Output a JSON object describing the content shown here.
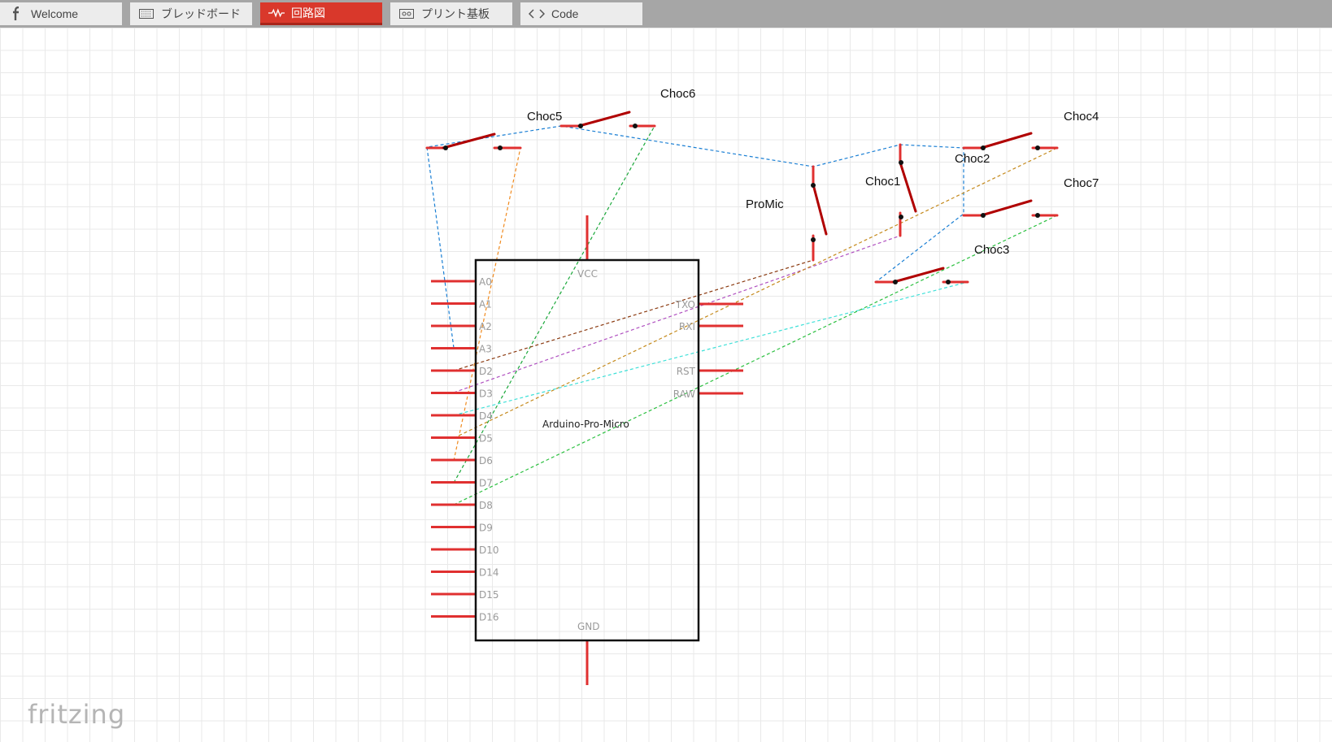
{
  "tabs": [
    {
      "label": "Welcome",
      "icon": "fritzing-f-icon",
      "active": false
    },
    {
      "label": "ブレッドボード",
      "icon": "breadboard-icon",
      "active": false
    },
    {
      "label": "回路図",
      "icon": "schematic-icon",
      "active": true
    },
    {
      "label": "プリント基板",
      "icon": "pcb-icon",
      "active": false
    },
    {
      "label": "Code",
      "icon": "code-icon",
      "active": false
    }
  ],
  "chip": {
    "name": "Arduino-Pro-Micro",
    "top_pin": "VCC",
    "bottom_pin": "GND",
    "left_pins": [
      "A0",
      "A1",
      "A2",
      "A3",
      "D2",
      "D3",
      "D4",
      "D5",
      "D6",
      "D7",
      "D8",
      "D9",
      "D10",
      "D14",
      "D15",
      "D16"
    ],
    "right_pins": [
      "TXO",
      "RXI",
      "RST",
      "RAW"
    ]
  },
  "parts": {
    "choc1": "Choc1",
    "choc2": "Choc2",
    "choc3": "Choc3",
    "choc4": "Choc4",
    "choc5": "Choc5",
    "choc6": "Choc6",
    "choc7": "Choc7",
    "promic": "ProMic"
  },
  "logo": "fritzing",
  "colors": {
    "active_tab": "#d9382b",
    "pin_red": "#e03030",
    "switch_red": "#b00000",
    "wire_blue": "#1a7fd4",
    "wire_orange": "#f08a1e",
    "wire_green": "#1aa83a",
    "wire_brown": "#8b3a10",
    "wire_purple": "#b050c0",
    "wire_gold": "#c58a1c",
    "wire_cyan": "#3ee0d8",
    "wire_green2": "#2cc040"
  }
}
